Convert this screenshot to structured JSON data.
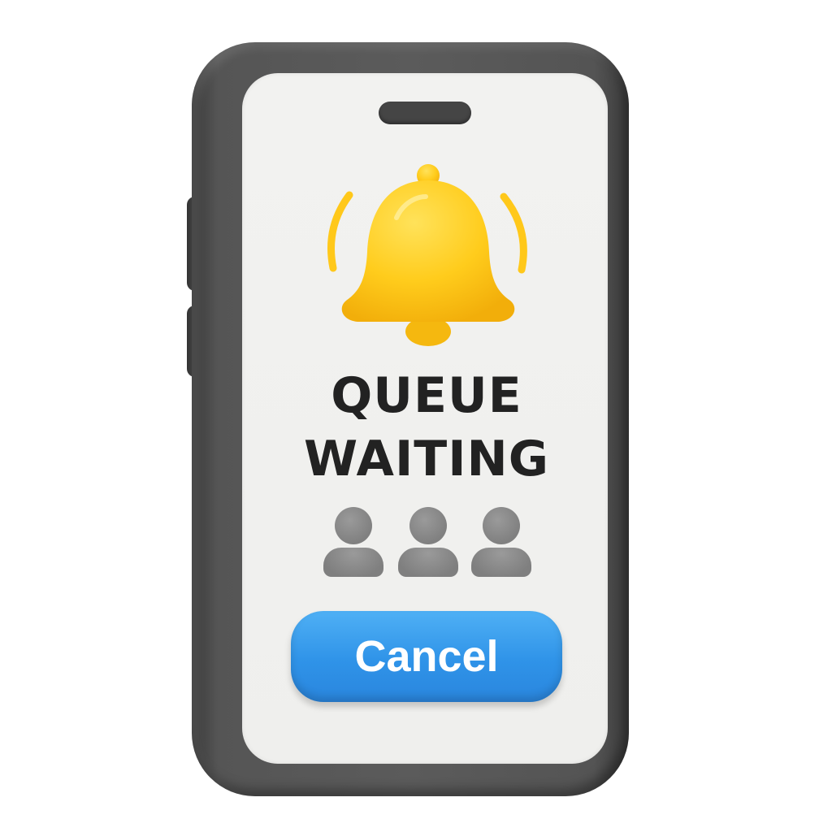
{
  "screen": {
    "title_line1": "QUEUE",
    "title_line2": "WAITING",
    "cancel_label": "Cancel"
  },
  "icons": {
    "bell": "bell-icon",
    "queue": [
      "person-icon",
      "person-icon",
      "person-icon"
    ]
  },
  "colors": {
    "device_frame": "#555555",
    "screen_background": "#F0F0EE",
    "bell_yellow": "#FFCE1F",
    "person_gray": "#8A8A8A",
    "title_text": "#222222",
    "cancel_button": "#2F93E8",
    "cancel_text": "#FFFFFF"
  }
}
